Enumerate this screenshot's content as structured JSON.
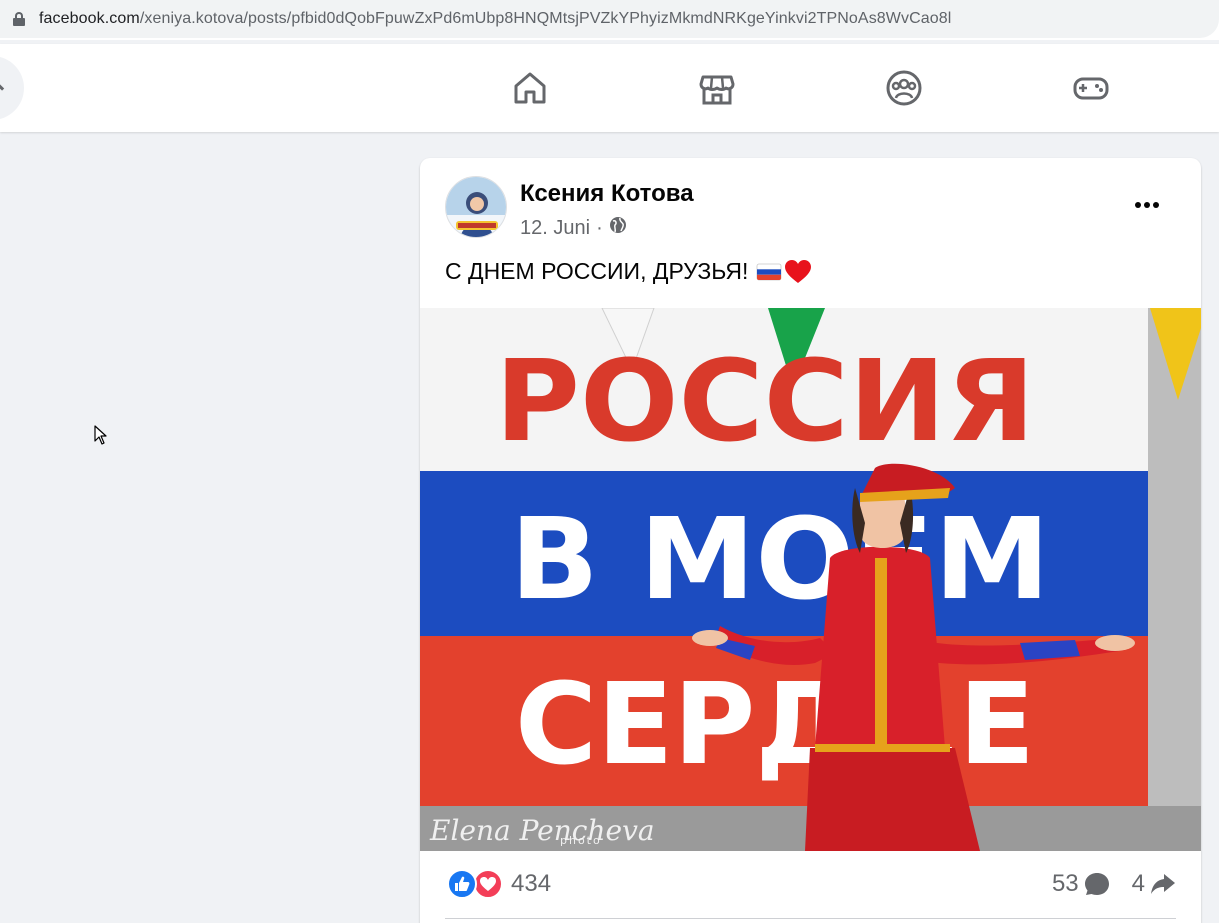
{
  "browser": {
    "url_domain": "facebook.com",
    "url_path": "/xeniya.kotova/posts/pfbid0dQobFpuwZxPd6mUbp8HNQMtsjPVZkYPhyizMkmdNRKgeYinkvi2TPNoAs8WvCao8l"
  },
  "nav": {
    "icons": [
      "home-icon",
      "marketplace-icon",
      "groups-icon",
      "gaming-icon"
    ]
  },
  "post": {
    "author": "Ксения Котова",
    "date": "12. Juni",
    "separator": "·",
    "audience_icon": "globe-icon",
    "text": "С ДНЕМ РОССИИ, ДРУЗЬЯ!",
    "text_emojis": [
      "russia-flag-emoji",
      "red-heart-emoji"
    ],
    "image": {
      "banner_lines": [
        "РОССИЯ",
        "В МОЁМ",
        "СЕРДЦЕ"
      ],
      "watermark": "Elena Pencheva",
      "watermark_sub": "photo"
    },
    "reactions": {
      "types": [
        "like",
        "love"
      ],
      "count": "434"
    },
    "comments_count": "53",
    "shares_count": "4"
  },
  "colors": {
    "fb_blue": "#1877f2",
    "love_red": "#f33e58",
    "flag_white": "#ffffff",
    "flag_blue": "#1c4cc0",
    "flag_red": "#e3412d"
  }
}
